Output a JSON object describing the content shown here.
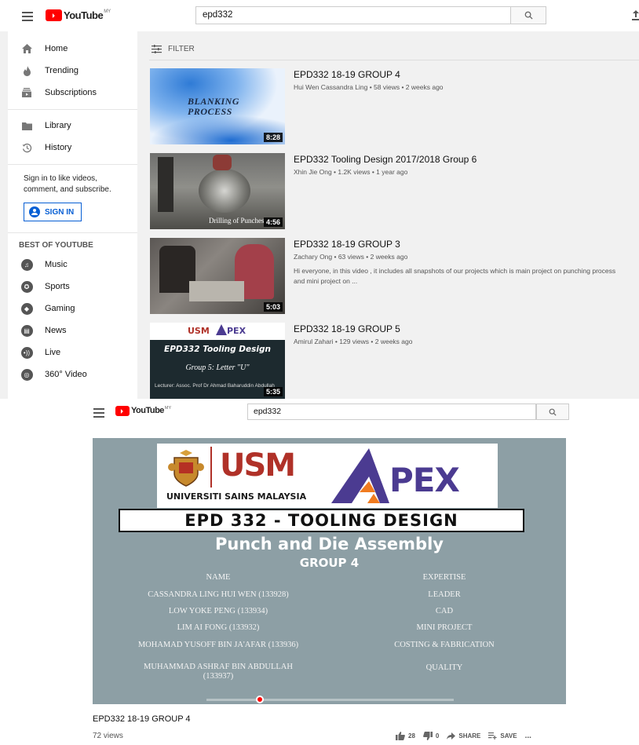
{
  "results_page": {
    "logo": {
      "word": "YouTube",
      "region": "MY"
    },
    "search": {
      "query": "epd332"
    },
    "sidebar": {
      "main": [
        {
          "label": "Home",
          "icon": "home-icon"
        },
        {
          "label": "Trending",
          "icon": "flame-icon"
        },
        {
          "label": "Subscriptions",
          "icon": "subscriptions-icon"
        }
      ],
      "library": [
        {
          "label": "Library",
          "icon": "folder-icon"
        },
        {
          "label": "History",
          "icon": "history-icon"
        }
      ],
      "signin_prompt": "Sign in to like videos, comment, and subscribe.",
      "signin_button": "SIGN IN",
      "best_heading": "BEST OF YOUTUBE",
      "best": [
        {
          "label": "Music",
          "icon": "music-icon"
        },
        {
          "label": "Sports",
          "icon": "sports-icon"
        },
        {
          "label": "Gaming",
          "icon": "gaming-icon"
        },
        {
          "label": "News",
          "icon": "news-icon"
        },
        {
          "label": "Live",
          "icon": "live-icon"
        },
        {
          "label": "360° Video",
          "icon": "360-video-icon"
        }
      ]
    },
    "filter_label": "FILTER",
    "results": [
      {
        "title": "EPD332 18-19 GROUP 4",
        "meta": "Hui Wen Cassandra Ling • 58 views • 2 weeks ago",
        "description": "",
        "duration": "8:28",
        "thumb_text": [
          "BLANKING",
          "PROCESS"
        ]
      },
      {
        "title": "EPD332 Tooling Design 2017/2018 Group 6",
        "meta": "Xhin Jie Ong • 1.2K views • 1 year ago",
        "description": "",
        "duration": "4:56",
        "thumb_text": [
          "Drilling of Punches"
        ]
      },
      {
        "title": "EPD332 18-19 GROUP 3",
        "meta": "Zachary Ong • 63 views • 2 weeks ago",
        "description": "Hi everyone, in this video , it includes all snapshots of our projects which is main project on punching process and mini project on ...",
        "duration": "5:03",
        "thumb_text": []
      },
      {
        "title": "EPD332 18-19 GROUP 5",
        "meta": "Amirul Zahari • 129 views • 2 weeks ago",
        "description": "",
        "duration": "5:35",
        "thumb_text": [
          "EPD332 Tooling Design",
          "Group 5: Letter \"U\"",
          "Lecturer: Assoc. Prof Dr Ahmad Baharuddin Abdullah"
        ]
      }
    ]
  },
  "watch_page": {
    "logo": {
      "word": "YouTube",
      "region": "MY"
    },
    "search": {
      "query": "epd332"
    },
    "slide": {
      "usm_text": "UNIVERSITI SAINS MALAYSIA",
      "apex_text": "PEX",
      "course": "EPD 332 - TOOLING DESIGN",
      "heading": "Punch and Die Assembly",
      "group": "GROUP 4",
      "columns": [
        "NAME",
        "EXPERTISE"
      ],
      "rows": [
        [
          "CASSANDRA LING HUI WEN (133928)",
          "LEADER"
        ],
        [
          "LOW YOKE PENG (133934)",
          "CAD"
        ],
        [
          "LIM AI FONG (133932)",
          "MINI PROJECT"
        ],
        [
          "MOHAMAD YUSOFF BIN JA'AFAR (133936)",
          "COSTING & FABRICATION"
        ],
        [
          "MUHAMMAD ASHRAF BIN ABDULLAH (133937)",
          "QUALITY"
        ]
      ]
    },
    "title": "EPD332 18-19 GROUP 4",
    "views": "72 views",
    "likes": "28",
    "dislikes": "0",
    "share_label": "SHARE",
    "save_label": "SAVE",
    "more_label": "..."
  },
  "colors": {
    "brand_red": "#ff0000",
    "link_blue": "#065fd4",
    "slide_bg": "#8d9fa5",
    "apex_purple": "#4b3b91",
    "apex_orange": "#f07b1f",
    "usm_red": "#c0392b"
  }
}
